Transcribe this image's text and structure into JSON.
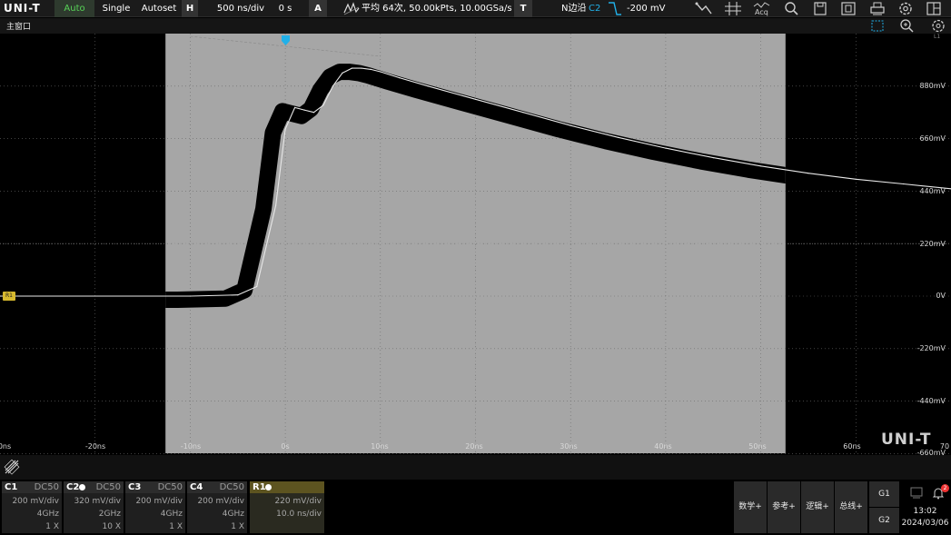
{
  "toolbar": {
    "logo": "UNI-T",
    "run_auto": "Auto",
    "single": "Single",
    "autoset": "Autoset",
    "horizontal_label": "H",
    "time_scale": "500 ns/div",
    "time_position": "0 s",
    "acquire_label": "A",
    "acquire_info": "平均 64次,  50.00kPts,  10.00GSa/s",
    "trigger_label": "T",
    "trigger_mode": "N边沿",
    "trigger_source": "C2",
    "trigger_level": "-200 mV",
    "acq_button": "Acq",
    "icons": [
      "waveform-icon",
      "cursor-icon",
      "acq-icon",
      "search-icon",
      "save-icon",
      "screenshot-icon",
      "print-icon",
      "settings-icon",
      "layout-icon"
    ]
  },
  "window": {
    "title": "主窗口",
    "icons": [
      "selection-icon",
      "zoom-icon",
      "settings-icon"
    ],
    "corner_label": "L1"
  },
  "plot": {
    "y_labels": [
      "880mV",
      "660mV",
      "440mV",
      "220mV",
      "0V",
      "-220mV",
      "-440mV",
      "-660mV"
    ],
    "x_labels": [
      "0ns",
      "-20ns",
      "-10ns",
      "0s",
      "10ns",
      "20ns",
      "30ns",
      "40ns",
      "50ns",
      "60ns",
      "70"
    ],
    "ref_marker": "R1",
    "watermark": "UNI-T",
    "colors": {
      "reference_bg": "#a6a6a6",
      "trace": "#000000",
      "ref_trace": "#e8e8e8",
      "trigger_marker": "#21b0e8",
      "ref_marker": "#d7b92e"
    }
  },
  "chart_data": {
    "type": "line",
    "title": "",
    "xlabel": "",
    "ylabel": "",
    "x_unit": "ns",
    "y_unit": "mV",
    "ylim": [
      -660,
      1100
    ],
    "xlim": [
      -30,
      70
    ],
    "series": [
      {
        "x": [
          -30,
          -10,
          -5,
          -3,
          -1,
          0,
          1,
          2,
          3,
          4,
          5,
          6,
          7,
          8,
          9,
          10,
          12,
          15,
          20,
          25,
          30,
          35,
          40,
          45,
          50,
          55,
          60,
          65,
          70
        ],
        "y": [
          0,
          0,
          5,
          40,
          380,
          700,
          790,
          780,
          770,
          800,
          880,
          935,
          955,
          955,
          950,
          940,
          915,
          880,
          825,
          770,
          715,
          665,
          620,
          580,
          545,
          515,
          490,
          470,
          450
        ]
      }
    ]
  },
  "channels": [
    {
      "name": "C1",
      "active": false,
      "coupling": "DC50",
      "scale": "200 mV/div",
      "bandwidth": "4GHz",
      "probe": "1 X"
    },
    {
      "name": "C2",
      "active": true,
      "coupling": "DC50",
      "scale": "320 mV/div",
      "bandwidth": "2GHz",
      "probe": "10 X"
    },
    {
      "name": "C3",
      "active": false,
      "coupling": "DC50",
      "scale": "200 mV/div",
      "bandwidth": "4GHz",
      "probe": "1 X"
    },
    {
      "name": "C4",
      "active": false,
      "coupling": "DC50",
      "scale": "200 mV/div",
      "bandwidth": "4GHz",
      "probe": "1 X"
    }
  ],
  "reference": {
    "name": "R1",
    "scale": "220 mV/div",
    "timebase": "10.0 ns/div"
  },
  "bottom_menu": {
    "math": "数学+",
    "ref": "参考+",
    "logic": "逻辑+",
    "bus": "总线+",
    "g1": "G1",
    "g2": "G2",
    "time": "13:02",
    "date": "2024/03/06",
    "notifications": "2"
  }
}
